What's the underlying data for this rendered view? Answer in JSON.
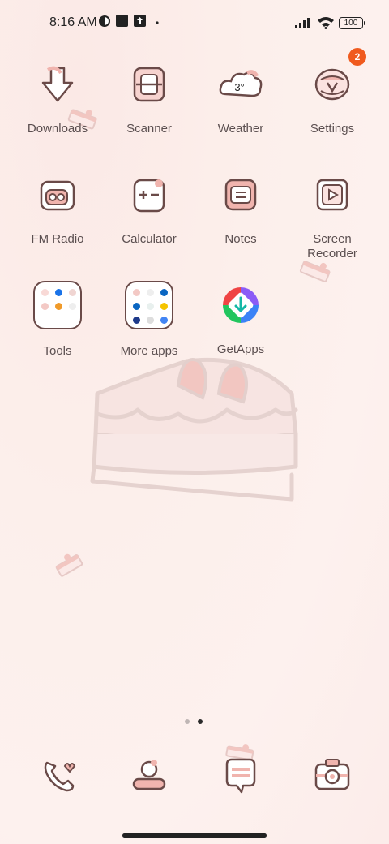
{
  "status_bar": {
    "time": "8:16 AM",
    "battery": "100"
  },
  "badges": {
    "settings": "2"
  },
  "apps": [
    {
      "label": "Downloads",
      "icon": "downloads-icon"
    },
    {
      "label": "Scanner",
      "icon": "scanner-icon"
    },
    {
      "label": "Weather",
      "icon": "weather-icon",
      "icon_text": "-3°"
    },
    {
      "label": "Settings",
      "icon": "settings-icon"
    },
    {
      "label": "FM Radio",
      "icon": "radio-icon"
    },
    {
      "label": "Calculator",
      "icon": "calculator-icon"
    },
    {
      "label": "Notes",
      "icon": "notes-icon"
    },
    {
      "label": "Screen\nRecorder",
      "icon": "screen-recorder-icon"
    },
    {
      "label": "Tools",
      "icon": "tools-folder-icon"
    },
    {
      "label": "More apps",
      "icon": "more-apps-folder-icon"
    },
    {
      "label": "GetApps",
      "icon": "getapps-icon"
    }
  ],
  "page_indicator": {
    "pages": 2,
    "current": 2
  },
  "dock": [
    {
      "icon": "phone-icon"
    },
    {
      "icon": "contacts-icon"
    },
    {
      "icon": "messages-icon"
    },
    {
      "icon": "camera-icon"
    }
  ],
  "colors": {
    "accent_pink": "#f0b4ae",
    "outline": "#6a4a48",
    "badge": "#f05a1e"
  }
}
